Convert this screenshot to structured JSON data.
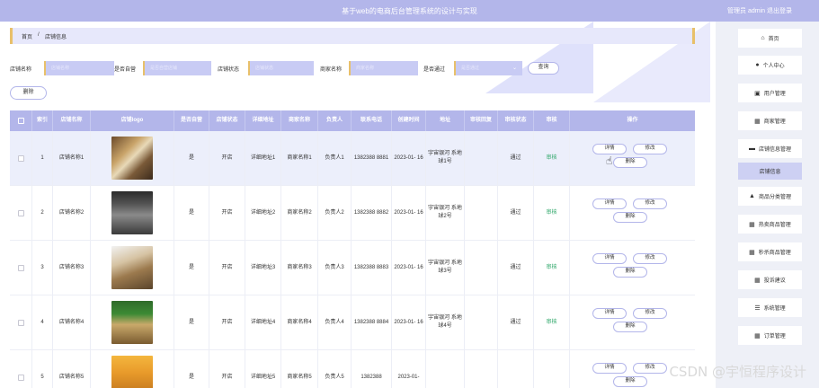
{
  "header": {
    "title": "基于web的电商后台管理系统的设计与实现",
    "user": "管理员 admin  退出登录"
  },
  "breadcrumb": {
    "home": "首页",
    "sep": "/",
    "current": "店铺信息"
  },
  "search": {
    "fields": [
      {
        "label": "店铺名称",
        "placeholder": "店铺名称"
      },
      {
        "label": "是否自营",
        "placeholder": "是否自营店铺",
        "select": true
      },
      {
        "label": "店铺状态",
        "placeholder": "店铺状态"
      },
      {
        "label": "商家名称",
        "placeholder": "商家名称"
      },
      {
        "label": "是否通过",
        "placeholder": "是否通过",
        "select": true
      }
    ],
    "query_label": "查询"
  },
  "toolbar": {
    "delete_label": "删除"
  },
  "table": {
    "columns": [
      "",
      "索引",
      "店铺名称",
      "店铺logo",
      "是否自营",
      "店铺状态",
      "详细地址",
      "商家名称",
      "负责人",
      "联系电话",
      "创建时间",
      "地址",
      "审核回复",
      "审核状态",
      "审核",
      "操作"
    ],
    "rows": [
      {
        "index": "1",
        "name": "店铺名称1",
        "self": "是",
        "status": "开店",
        "addr": "详细地址1",
        "merchant": "商家名称1",
        "owner": "负责人1",
        "phone": "1382388 8881",
        "created": "2023-01- 16",
        "location": "宇宙银河 系地球1号",
        "reply": "",
        "audit_status": "通过",
        "audit": "审核"
      },
      {
        "index": "2",
        "name": "店铺名称2",
        "self": "是",
        "status": "开店",
        "addr": "详细地址2",
        "merchant": "商家名称2",
        "owner": "负责人2",
        "phone": "1382388 8882",
        "created": "2023-01- 16",
        "location": "宇宙银河 系地球2号",
        "reply": "",
        "audit_status": "通过",
        "audit": "审核"
      },
      {
        "index": "3",
        "name": "店铺名称3",
        "self": "是",
        "status": "开店",
        "addr": "详细地址3",
        "merchant": "商家名称3",
        "owner": "负责人3",
        "phone": "1382388 8883",
        "created": "2023-01- 16",
        "location": "宇宙银河 系地球3号",
        "reply": "",
        "audit_status": "通过",
        "audit": "审核"
      },
      {
        "index": "4",
        "name": "店铺名称4",
        "self": "是",
        "status": "开店",
        "addr": "详细地址4",
        "merchant": "商家名称4",
        "owner": "负责人4",
        "phone": "1382388 8884",
        "created": "2023-01- 16",
        "location": "宇宙银河 系地球4号",
        "reply": "",
        "audit_status": "通过",
        "audit": "审核"
      },
      {
        "index": "5",
        "name": "店铺名称5",
        "self": "是",
        "status": "开店",
        "addr": "详细地址5",
        "merchant": "商家名称5",
        "owner": "负责人5",
        "phone": "1382388",
        "created": "2023-01-",
        "location": "",
        "reply": "",
        "audit_status": "",
        "audit": ""
      }
    ],
    "actions": {
      "detail": "详情",
      "edit": "修改",
      "delete": "删除"
    }
  },
  "sidebar": {
    "items": [
      {
        "label": "首页",
        "icon": "home-icon"
      },
      {
        "label": "个人中心",
        "icon": "person-icon"
      },
      {
        "label": "用户管理",
        "icon": "user-icon"
      },
      {
        "label": "商家管理",
        "icon": "grid-icon"
      },
      {
        "label": "店铺信息管理",
        "icon": "store-icon"
      },
      {
        "label": "店铺信息",
        "icon": "",
        "sub": true
      },
      {
        "label": "商品分类管理",
        "icon": "category-icon"
      },
      {
        "label": "热卖商品管理",
        "icon": "grid-icon"
      },
      {
        "label": "秒杀商品管理",
        "icon": "grid-icon"
      },
      {
        "label": "投诉建议",
        "icon": "grid-icon"
      },
      {
        "label": "系统管理",
        "icon": "menu-icon"
      },
      {
        "label": "订单管理",
        "icon": "grid-icon"
      }
    ]
  },
  "watermark": "CSDN @宇恒程序设计",
  "colors": {
    "accent": "#b3b6ea",
    "gold": "#e8c06a",
    "audit_green": "#2fa76a"
  }
}
